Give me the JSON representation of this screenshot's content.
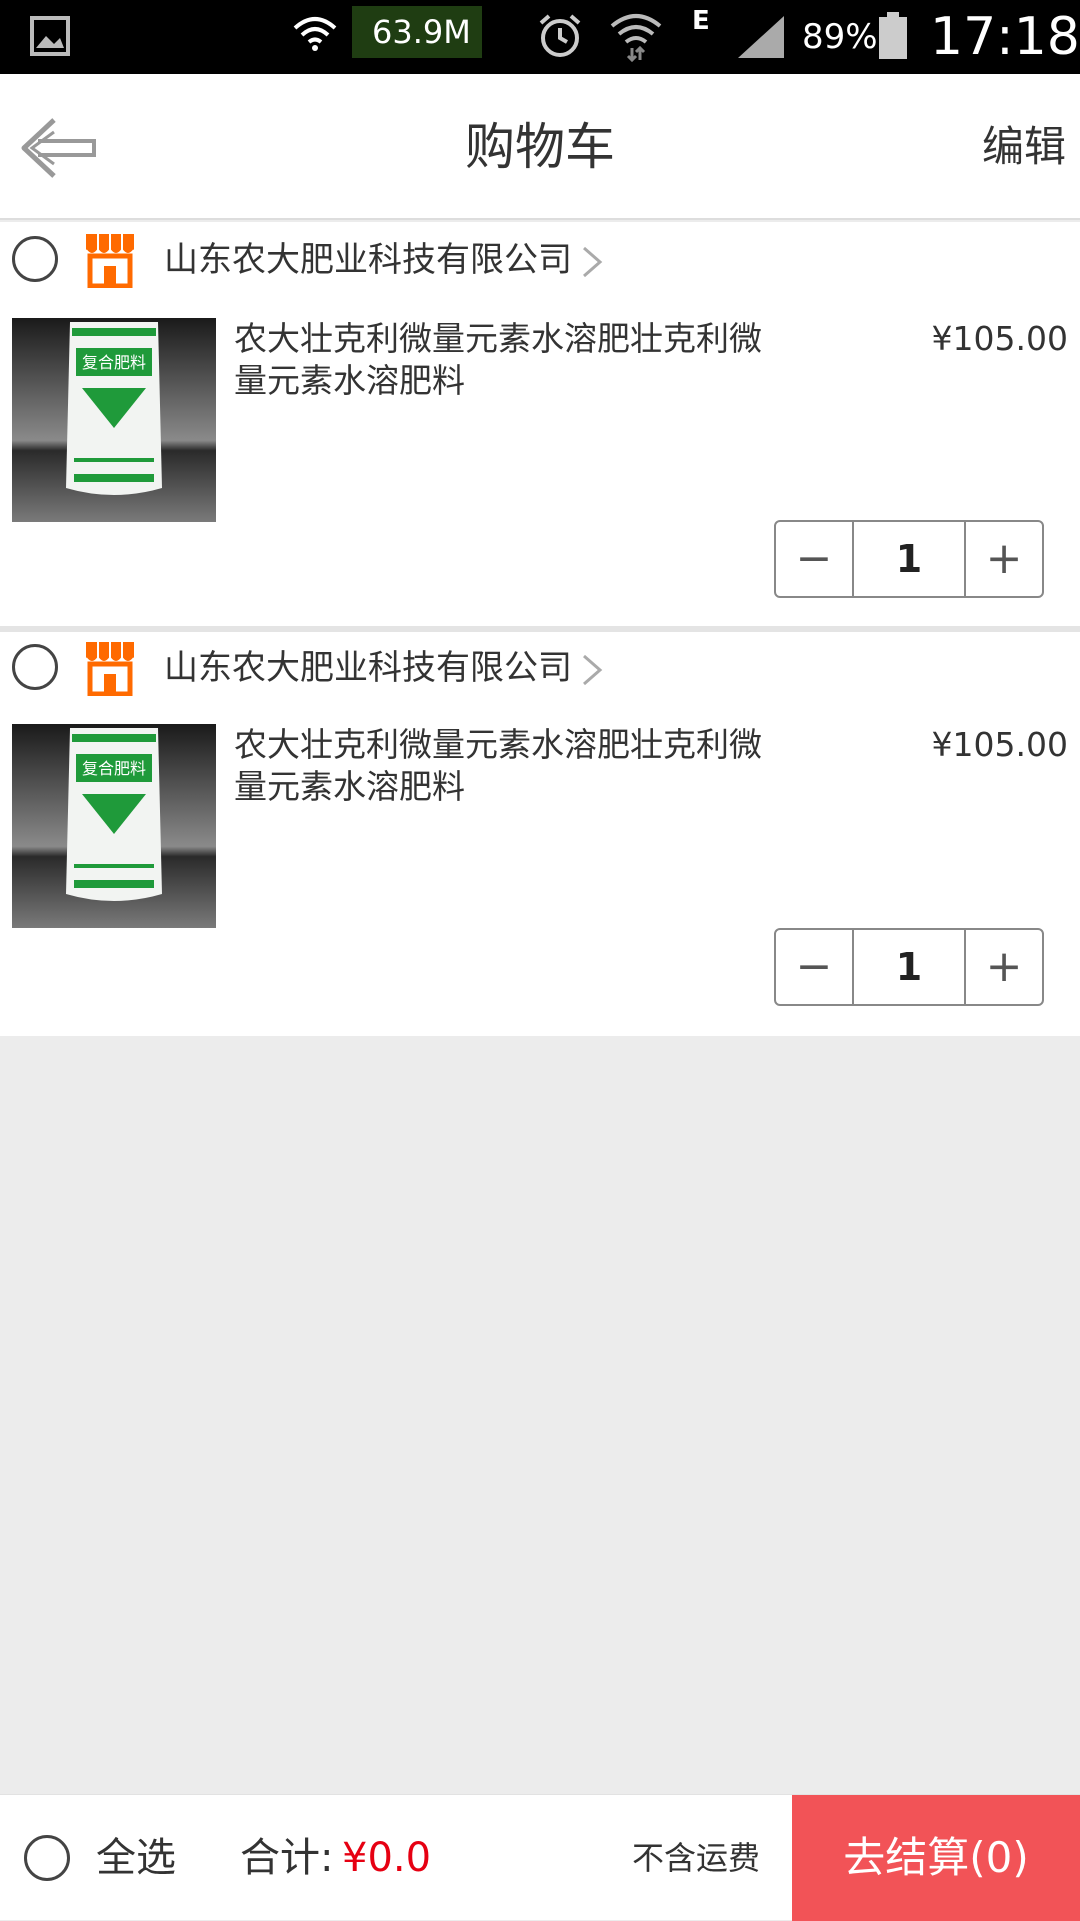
{
  "status_bar": {
    "net_speed": "63.9M",
    "network_type": "E",
    "battery_percent": "89%",
    "time": "17:18",
    "icons": [
      "gallery-icon",
      "wifi-icon",
      "alarm-icon",
      "wifi-data-icon",
      "signal-icon",
      "battery-icon"
    ]
  },
  "header": {
    "title": "购物车",
    "edit_label": "编辑",
    "back_icon": "back-arrow-icon"
  },
  "stores": [
    {
      "name": "山东农大肥业科技有限公司",
      "product": {
        "title": "农大壮克利微量元素水溶肥壮克利微量元素水溶肥料",
        "price": "¥105.00",
        "quantity": "1",
        "image_text": "复合肥料"
      }
    },
    {
      "name": "山东农大肥业科技有限公司",
      "product": {
        "title": "农大壮克利微量元素水溶肥壮克利微量元素水溶肥料",
        "price": "¥105.00",
        "quantity": "1",
        "image_text": "复合肥料"
      }
    }
  ],
  "qty_controls": {
    "minus": "−",
    "plus": "+"
  },
  "bottom_bar": {
    "select_all_label": "全选",
    "total_label": "合计:",
    "total_value": "¥0.0",
    "shipping_note": "不含运费",
    "checkout_label": "去结算(0)"
  },
  "colors": {
    "accent_red": "#f25357",
    "price_red": "#e60012",
    "shop_icon_orange": "#ff6a00",
    "product_green": "#1f9a3a"
  }
}
